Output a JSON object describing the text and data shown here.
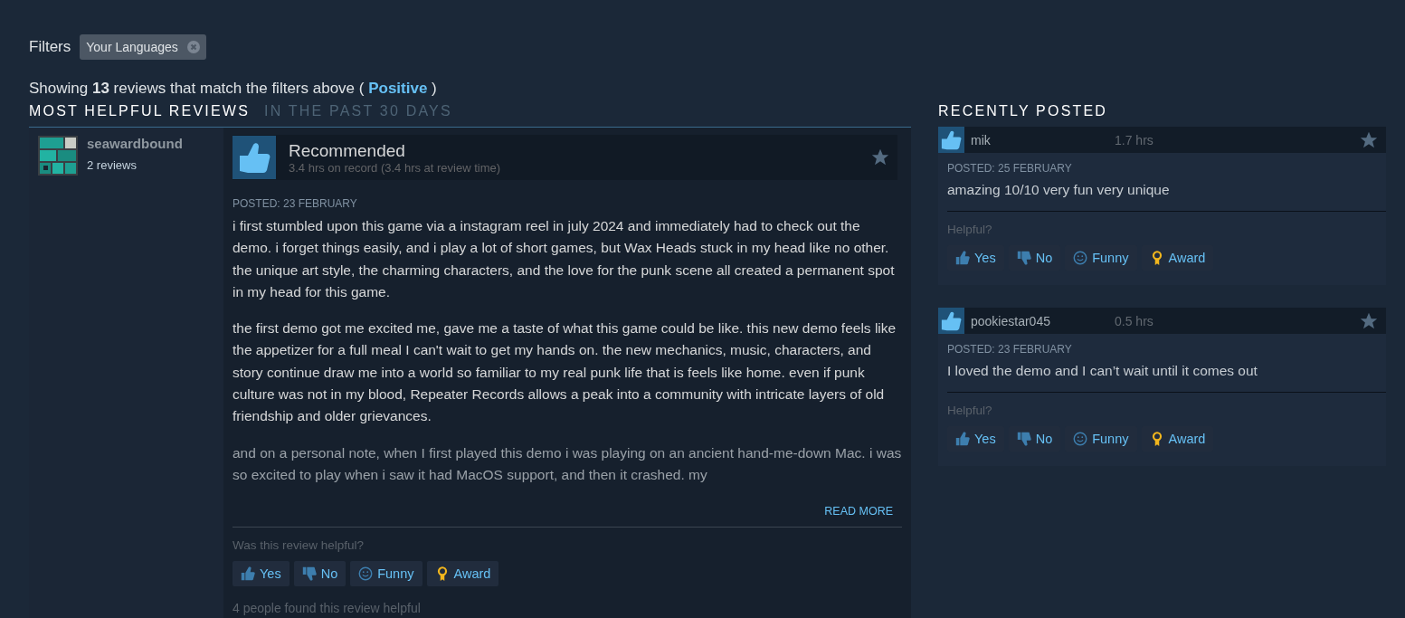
{
  "filters": {
    "label": "Filters",
    "chips": [
      {
        "label": "Your Languages"
      }
    ]
  },
  "summary": {
    "prefix": "Showing",
    "count": "13",
    "middle": "reviews that match the filters above (",
    "filter": "Positive",
    "suffix": ")"
  },
  "main_heading": {
    "title": "MOST HELPFUL REVIEWS",
    "subtitle": "IN THE PAST 30 DAYS"
  },
  "side_heading": "RECENTLY POSTED",
  "review": {
    "author": "seawardbound",
    "author_reviews": "2 reviews",
    "verdict": "Recommended",
    "hours": "3.4 hrs on record (3.4 hrs at review time)",
    "posted": "POSTED: 23 FEBRUARY",
    "paragraphs": [
      "i first stumbled upon this game via a instagram reel in july 2024 and immediately had to check out the demo. i forget things easily, and i play a lot of short games, but Wax Heads stuck in my head like no other. the unique art style, the charming characters, and the love for the punk scene all created a permanent spot in my head for this game.",
      "the first demo got me excited me, gave me a taste of what this game could be like. this new demo feels like the appetizer for a full meal I can't wait to get my hands on. the new mechanics, music, characters, and story continue draw me into a world so familiar to my real punk life that is feels like home. even if punk culture was not in my blood, Repeater Records allows a peak into a community with intricate layers of old friendship and older grievances.",
      "and on a personal note, when I first played this demo i was playing on an ancient hand-me-down Mac. i was so excited to play when i saw it had MacOS support, and then it crashed. my"
    ],
    "read_more": "READ MORE",
    "helpful_prompt": "Was this review helpful?",
    "buttons": [
      {
        "kind": "yes",
        "label": "Yes"
      },
      {
        "kind": "no",
        "label": "No"
      },
      {
        "kind": "funny",
        "label": "Funny"
      },
      {
        "kind": "award",
        "label": "Award"
      }
    ],
    "helpful_count": "4 people found this review helpful"
  },
  "recent": [
    {
      "author": "mik",
      "hours": "1.7 hrs",
      "posted": "POSTED: 25 FEBRUARY",
      "text": "amazing 10/10 very fun very unique",
      "helpful_prompt": "Helpful?",
      "buttons": [
        {
          "kind": "yes",
          "label": "Yes"
        },
        {
          "kind": "no",
          "label": "No"
        },
        {
          "kind": "funny",
          "label": "Funny"
        },
        {
          "kind": "award",
          "label": "Award"
        }
      ]
    },
    {
      "author": "pookiestar045",
      "hours": "0.5 hrs",
      "posted": "POSTED: 23 FEBRUARY",
      "text": "I loved the demo and I can’t wait until it comes out",
      "helpful_prompt": "Helpful?",
      "buttons": [
        {
          "kind": "yes",
          "label": "Yes"
        },
        {
          "kind": "no",
          "label": "No"
        },
        {
          "kind": "funny",
          "label": "Funny"
        },
        {
          "kind": "award",
          "label": "Award"
        }
      ]
    }
  ]
}
